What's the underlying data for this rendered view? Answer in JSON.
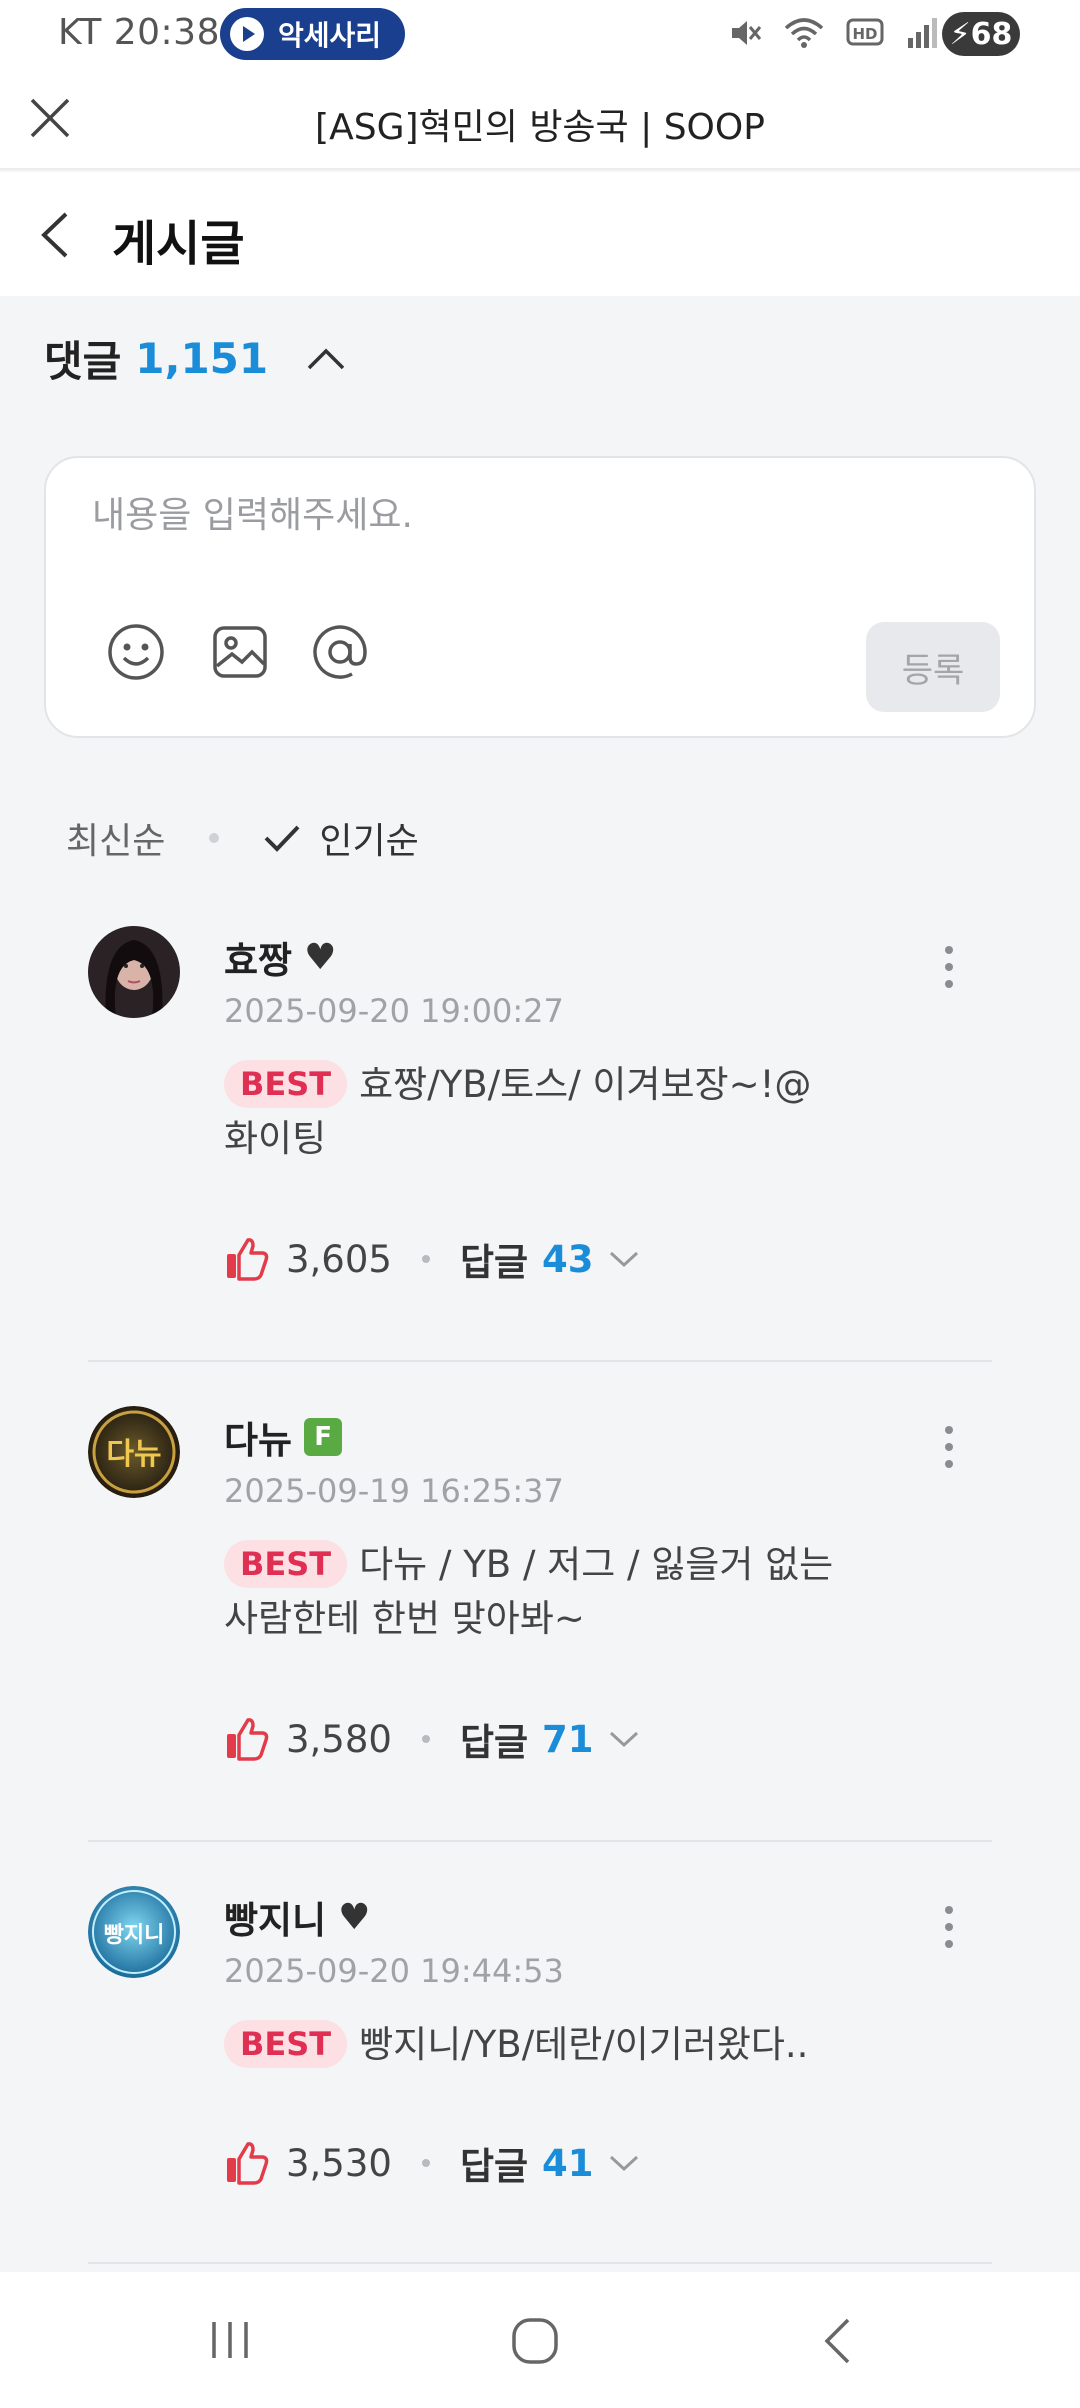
{
  "status_bar": {
    "carrier_time": "KT 20:38",
    "media_pill": "악세사리",
    "battery": "68"
  },
  "browser": {
    "title": "[ASG]혁민의 방송국 | SOOP"
  },
  "page": {
    "title": "게시글"
  },
  "comments_header": {
    "label": "댓글",
    "count": "1,151"
  },
  "composer": {
    "placeholder": "내용을 입력해주세요.",
    "submit_label": "등록"
  },
  "sort": {
    "latest": "최신순",
    "popular": "인기순",
    "active": "popular"
  },
  "comments": [
    {
      "username": "효짱",
      "time": "2025-09-20 19:00:27",
      "badge": "BEST",
      "text": "효짱/YB/토스/ 이겨보장~!@화이팅",
      "likes": "3,605",
      "reply_label": "답글",
      "reply_count": "43"
    },
    {
      "username": "다뉴",
      "fan_badge": "F",
      "time": "2025-09-19 16:25:37",
      "badge": "BEST",
      "text": "다뉴 / YB / 저그 / 잃을거 없는 사람한테 한번 맞아봐~",
      "likes": "3,580",
      "reply_label": "답글",
      "reply_count": "71"
    },
    {
      "username": "빵지니",
      "time": "2025-09-20 19:44:53",
      "badge": "BEST",
      "text": "빵지니/YB/테란/이기러왔다..",
      "likes": "3,530",
      "reply_label": "답글",
      "reply_count": "41"
    }
  ],
  "avatars": {
    "c2_text": "다뉴",
    "c3_text": "빵지니"
  },
  "colors": {
    "accent": "#1a8cd8",
    "best_bg": "#fde0e4",
    "best_text": "#e02f52",
    "like": "#e23b4a"
  }
}
